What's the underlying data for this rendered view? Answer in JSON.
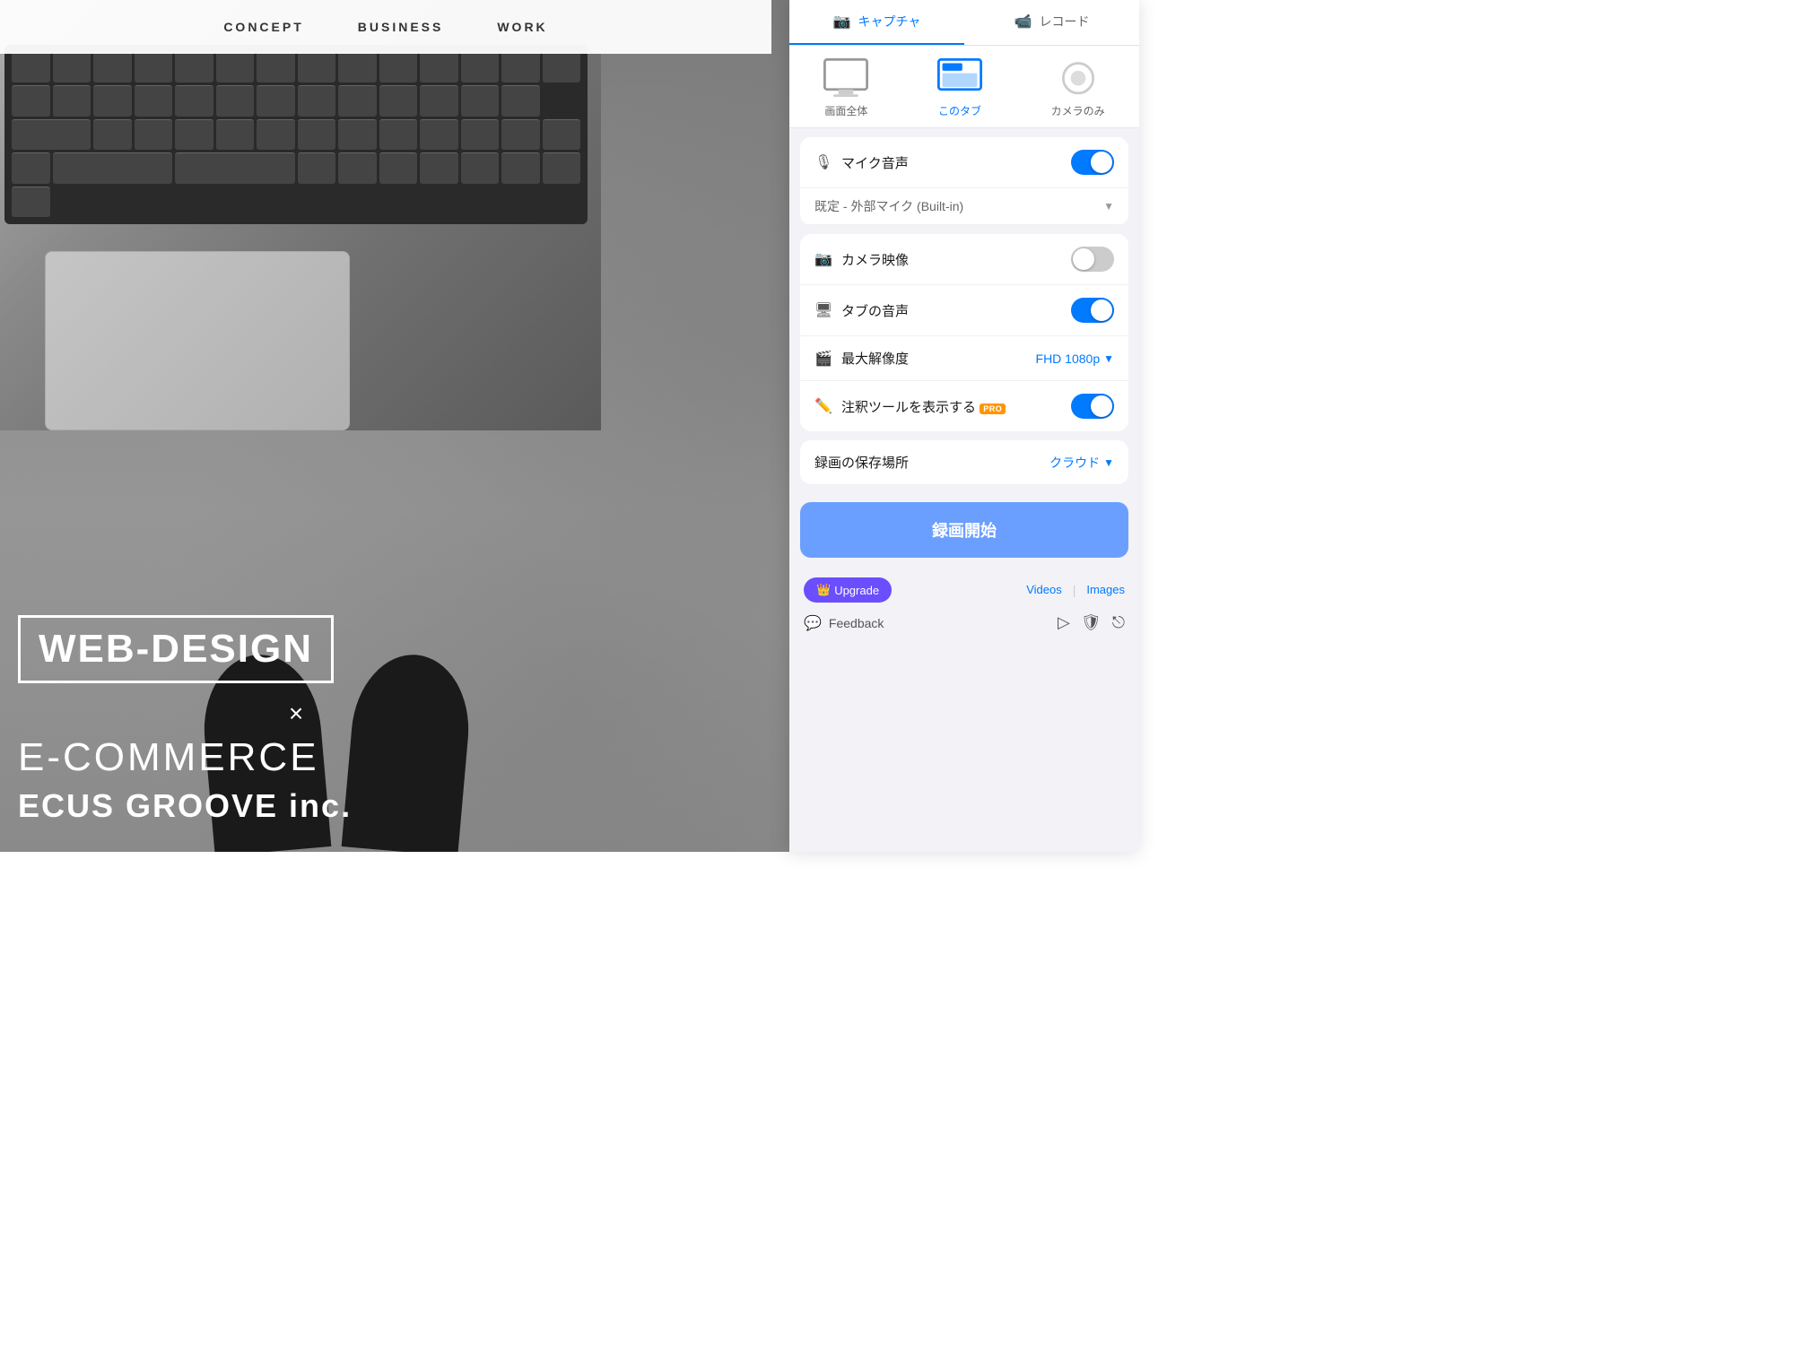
{
  "website": {
    "nav": {
      "items": [
        "CONCEPT",
        "BUSINESS",
        "WORK"
      ]
    },
    "hero": {
      "web_design": "WEB-DESIGN",
      "cross": "×",
      "ecommerce": "E-COMMERCE",
      "company": "ECUS GROOVE inc."
    }
  },
  "panel": {
    "header": {
      "capture_tab": "キャプチャ",
      "record_tab": "レコード"
    },
    "modes": {
      "full_screen": "画面全体",
      "this_tab": "このタブ",
      "camera_only": "カメラのみ"
    },
    "settings": {
      "mic_label": "マイク音声",
      "mic_default": "既定 - 外部マイク (Built-in)",
      "camera_label": "カメラ映像",
      "tab_audio_label": "タブの音声",
      "resolution_label": "最大解像度",
      "resolution_value": "FHD 1080p",
      "annotation_label": "注釈ツールを表示する",
      "annotation_pro": "PRO",
      "mic_on": true,
      "camera_on": false,
      "tab_audio_on": true,
      "annotation_on": true
    },
    "save": {
      "label": "録画の保存場所",
      "value": "クラウド"
    },
    "record_button": "録画開始",
    "footer": {
      "upgrade_label": "Upgrade",
      "videos_link": "Videos",
      "images_link": "Images",
      "feedback_label": "Feedback"
    }
  }
}
